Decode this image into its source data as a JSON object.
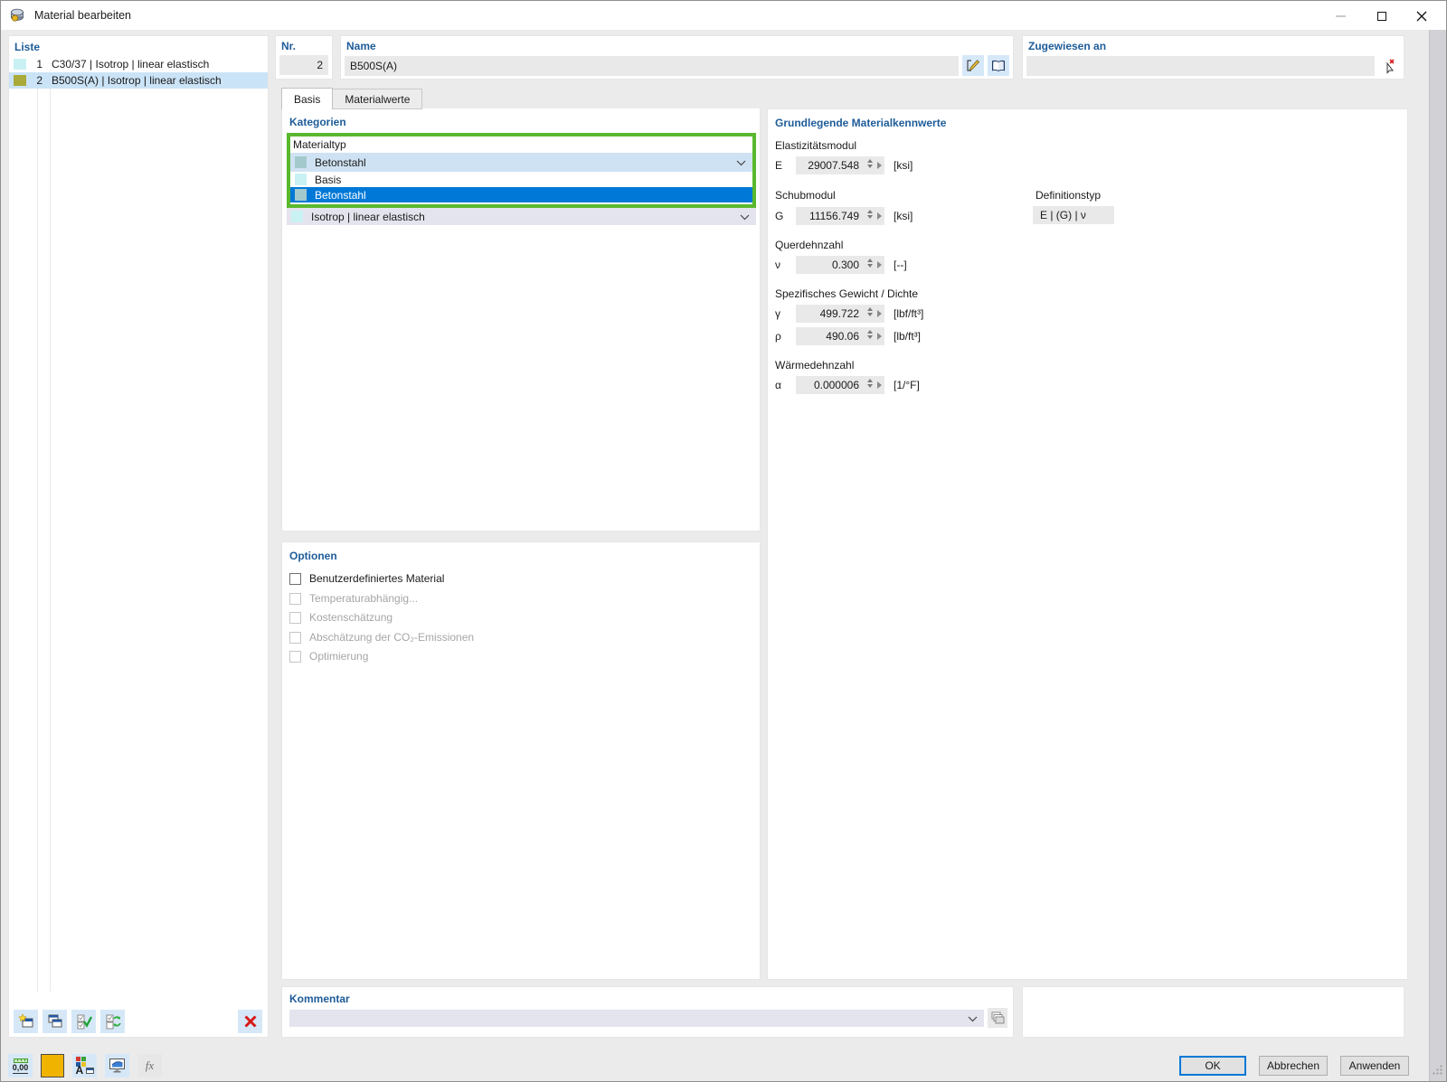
{
  "colors": {
    "accent-blue": "#1e5c99",
    "selection-blue": "#0078d7",
    "combo-blue": "#cfe2f3",
    "combo-lavender": "#e4e4ee",
    "row-selected": "#cbe3f6",
    "icon-btn-blue": "#d6e8f8",
    "highlight-green": "#5ab82e",
    "swatch-cyan": "#c9f1f3",
    "swatch-olive": "#a9aa3a",
    "swatch-teal": "#a3c9cd",
    "field-gray": "#e9e9e9"
  },
  "window": {
    "title": "Material bearbeiten"
  },
  "liste": {
    "title": "Liste",
    "items": [
      {
        "nr": "1",
        "label": "C30/37 | Isotrop | linear elastisch"
      },
      {
        "nr": "2",
        "label": "B500S(A) | Isotrop | linear elastisch"
      }
    ]
  },
  "header": {
    "nr_label": "Nr.",
    "nr_value": "2",
    "name_label": "Name",
    "name_value": "B500S(A)",
    "assigned_label": "Zugewiesen an",
    "assigned_value": ""
  },
  "tabs": {
    "basis": "Basis",
    "materialwerte": "Materialwerte"
  },
  "kategorien": {
    "title": "Kategorien",
    "materialtyp_label": "Materialtyp",
    "materialtyp_value": "Betonstahl",
    "options": [
      {
        "label": "Basis"
      },
      {
        "label": "Betonstahl"
      }
    ],
    "modell_value": "Isotrop | linear elastisch"
  },
  "optionen": {
    "title": "Optionen",
    "items": [
      {
        "label": "Benutzerdefiniertes Material",
        "enabled": true,
        "checked": false
      },
      {
        "label": "Temperaturabhängig...",
        "enabled": false,
        "checked": false
      },
      {
        "label": "Kostenschätzung",
        "enabled": false,
        "checked": false
      },
      {
        "label": "Abschätzung der CO₂-Emissionen",
        "enabled": false,
        "checked": false
      },
      {
        "label": "Optimierung",
        "enabled": false,
        "checked": false
      }
    ]
  },
  "kennwerte": {
    "title": "Grundlegende Materialkennwerte",
    "elastizitaetsmodul_label": "Elastizitätsmodul",
    "e_symbol": "E",
    "e_value": "29007.548",
    "e_unit": "[ksi]",
    "schubmodul_label": "Schubmodul",
    "g_symbol": "G",
    "g_value": "11156.749",
    "g_unit": "[ksi]",
    "definitionstyp_label": "Definitionstyp",
    "definitionstyp_value": "E | (G) | ν",
    "querdehnzahl_label": "Querdehnzahl",
    "nu_symbol": "ν",
    "nu_value": "0.300",
    "nu_unit": "[--]",
    "gewicht_label": "Spezifisches Gewicht / Dichte",
    "gamma_symbol": "γ",
    "gamma_value": "499.722",
    "gamma_unit": "[lbf/ft³]",
    "rho_symbol": "ρ",
    "rho_value": "490.06",
    "rho_unit": "[lb/ft³]",
    "waermedehnzahl_label": "Wärmedehnzahl",
    "alpha_symbol": "α",
    "alpha_value": "0.000006",
    "alpha_unit": "[1/°F]"
  },
  "kommentar": {
    "title": "Kommentar",
    "value": ""
  },
  "toolbar": {
    "units_label": "0,00",
    "font_letter": "A",
    "fx_label": "fx"
  },
  "footer": {
    "ok": "OK",
    "cancel": "Abbrechen",
    "apply": "Anwenden"
  }
}
